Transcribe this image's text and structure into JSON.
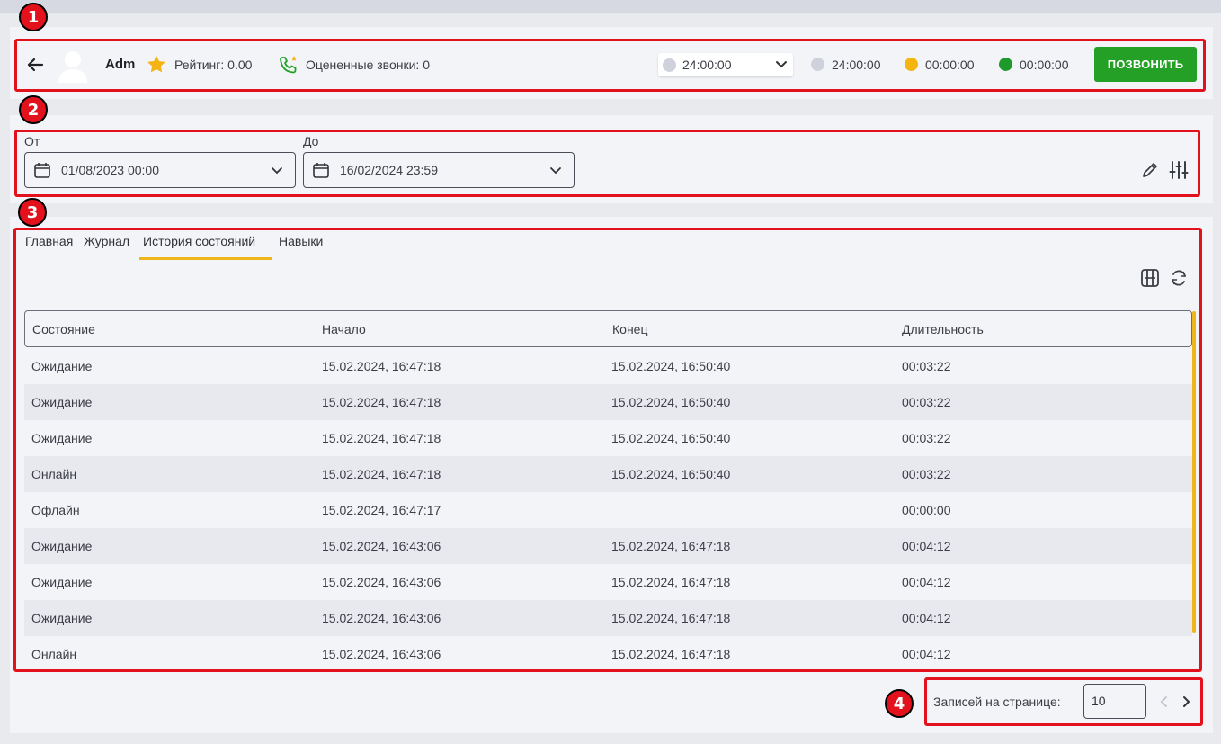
{
  "header": {
    "back_icon": "arrow-left-icon",
    "user_name": "Adm",
    "rating_label": "Рейтинг: 0.00",
    "rated_calls_label": "Оцененные звонки: 0",
    "status_select_value": "24:00:00",
    "status_times": [
      "24:00:00",
      "00:00:00",
      "00:00:00"
    ],
    "status_colors": [
      "#cfd2dc",
      "#f6b40e",
      "#1e9a2a"
    ],
    "call_button_label": "ПОЗВОНИТЬ",
    "call_button_color": "#23a025"
  },
  "filters": {
    "from_label": "От",
    "from_value": "01/08/2023 00:00",
    "to_label": "До",
    "to_value": "16/02/2024 23:59"
  },
  "tabs": [
    "Главная",
    "Журнал",
    "История состояний",
    "Навыки"
  ],
  "active_tab": "История состояний",
  "table": {
    "columns": [
      "Состояние",
      "Начало",
      "Конец",
      "Длительность"
    ],
    "rows": [
      [
        "Ожидание",
        "15.02.2024, 16:47:18",
        "15.02.2024, 16:50:40",
        "00:03:22"
      ],
      [
        "Ожидание",
        "15.02.2024, 16:47:18",
        "15.02.2024, 16:50:40",
        "00:03:22"
      ],
      [
        "Ожидание",
        "15.02.2024, 16:47:18",
        "15.02.2024, 16:50:40",
        "00:03:22"
      ],
      [
        "Онлайн",
        "15.02.2024, 16:47:18",
        "15.02.2024, 16:50:40",
        "00:03:22"
      ],
      [
        "Офлайн",
        "15.02.2024, 16:47:17",
        "",
        "00:00:00"
      ],
      [
        "Ожидание",
        "15.02.2024, 16:43:06",
        "15.02.2024, 16:47:18",
        "00:04:12"
      ],
      [
        "Ожидание",
        "15.02.2024, 16:43:06",
        "15.02.2024, 16:47:18",
        "00:04:12"
      ],
      [
        "Ожидание",
        "15.02.2024, 16:43:06",
        "15.02.2024, 16:47:18",
        "00:04:12"
      ],
      [
        "Онлайн",
        "15.02.2024, 16:43:06",
        "15.02.2024, 16:47:18",
        "00:04:12"
      ]
    ]
  },
  "pagination": {
    "per_page_label": "Записей на странице:",
    "per_page_value": "10"
  },
  "annotations": [
    "1",
    "2",
    "3",
    "4"
  ],
  "accent_color": "#f0b51a",
  "highlight_color": "#e3111b"
}
